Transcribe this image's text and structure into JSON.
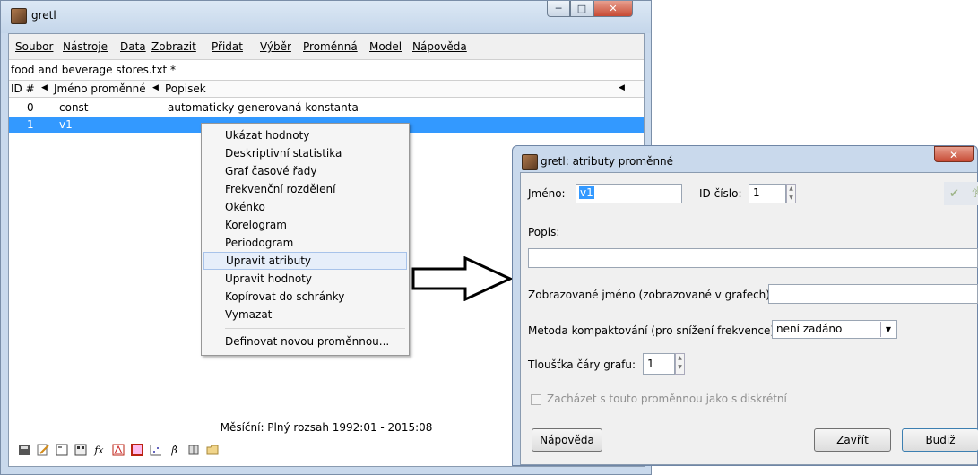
{
  "main_window": {
    "title": "gretl",
    "menu": [
      "Soubor",
      "Nástroje",
      "Data",
      "Zobrazit",
      "Přidat",
      "Výběr",
      "Proměnná",
      "Model",
      "Nápověda"
    ],
    "filename": "food and beverage stores.txt *",
    "columns": {
      "id": "ID #",
      "name": "Jméno proměnné",
      "desc": "Popisek"
    },
    "rows": [
      {
        "id": "0",
        "name": "const",
        "desc": "automaticky generovaná konstanta"
      },
      {
        "id": "1",
        "name": "v1",
        "desc": ""
      }
    ],
    "status": "Měsíční: Plný rozsah 1992:01 - 2015:08",
    "toolbar_icons": [
      "calculator-icon",
      "edit-script-icon",
      "terminal-icon",
      "session-icon",
      "function-icon",
      "pdf-icon",
      "bundle-icon",
      "scatter-plot-icon",
      "beta-hat-icon",
      "database-icon",
      "folder-icon"
    ]
  },
  "context_menu": {
    "items": [
      "Ukázat hodnoty",
      "Deskriptivní statistika",
      "Graf časové řady",
      "Frekvenční rozdělení",
      "Okénko",
      "Korelogram",
      "Periodogram",
      "Upravit atributy",
      "Upravit hodnoty",
      "Kopírovat do schránky",
      "Vymazat",
      "Definovat novou proměnnou..."
    ],
    "highlighted": "Upravit atributy"
  },
  "dialog": {
    "title": "gretl: atributy proměnné",
    "name_label": "Jméno:",
    "name_value": "v1",
    "id_label": "ID číslo:",
    "id_value": "1",
    "desc_label": "Popis:",
    "desc_value": "",
    "display_name_label": "Zobrazované jméno (zobrazované v grafech):",
    "display_name_value": "",
    "compact_label": "Metoda kompaktování (pro snížení frekvence):",
    "compact_value": "není zadáno",
    "linewidth_label": "Tloušťka čáry grafu:",
    "linewidth_value": "1",
    "discrete_label": "Zacházet s touto proměnnou jako s diskrétní",
    "help_button": "Nápověda",
    "close_button": "Zavřít",
    "ok_button": "Budiž"
  }
}
